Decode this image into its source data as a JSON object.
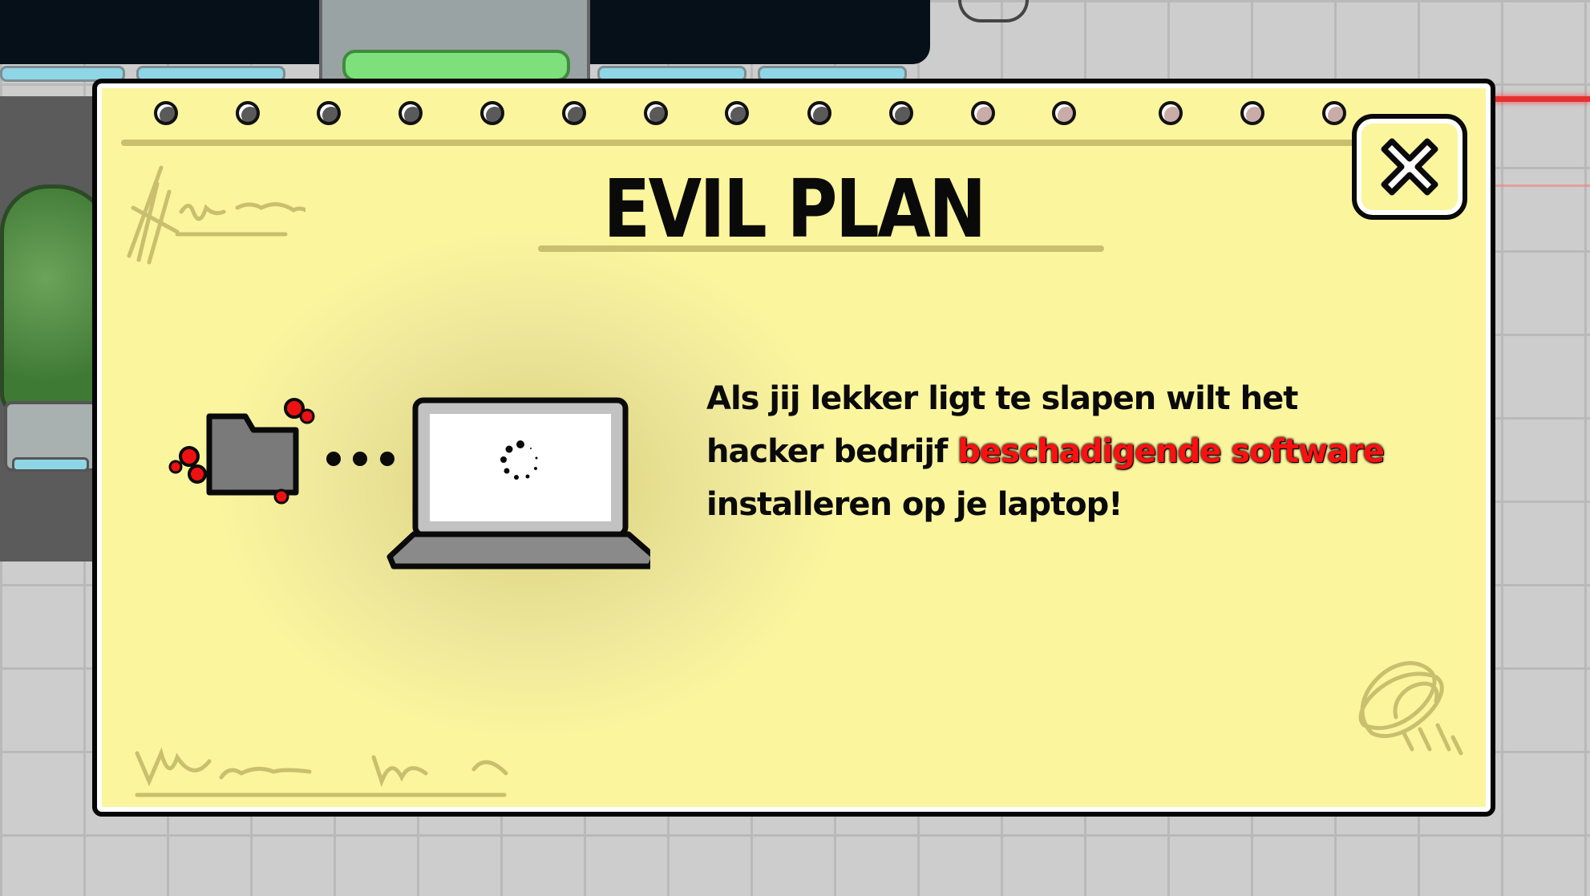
{
  "modal": {
    "title": "EVIL PLAN",
    "description": {
      "part1": "Als jij lekker ligt te slapen wilt het hacker bedrijf",
      "highlight": "beschadigende software",
      "part2": "installeren op je laptop!"
    },
    "highlight_color": "#ff1010",
    "background_color": "#fbf59e",
    "close_icon": "close-icon"
  },
  "illustration": {
    "icons": [
      "infected-folder-icon",
      "transfer-dots",
      "laptop-icon",
      "loading-spinner-icon"
    ]
  }
}
